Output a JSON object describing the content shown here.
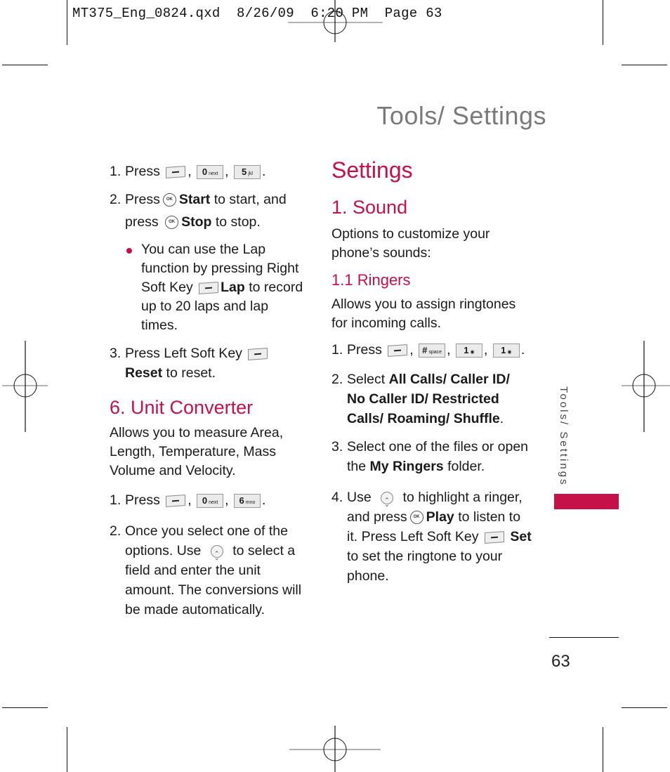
{
  "slug": {
    "filename": "MT375_Eng_0824.qxd",
    "date": "8/26/09",
    "time": "6:20 PM",
    "page_label": "Page 63"
  },
  "header": {
    "title": "Tools/ Settings"
  },
  "colors": {
    "accent": "#c5104a",
    "title_gray": "#7a7a7a",
    "text": "#1a1a1a"
  },
  "left_column": {
    "stopwatch_steps": [
      {
        "num": "1.",
        "text_before": "Press",
        "keys": [
          "left-soft-key",
          "0 next",
          "5 jkl"
        ],
        "text_after": "."
      },
      {
        "num": "2.",
        "line1_before": "Press",
        "line1_bold": "Start",
        "line1_after": "to start, and",
        "line2_before": "press",
        "line2_bold": "Stop",
        "line2_after": "to stop."
      }
    ],
    "bullet": {
      "text1": "You can use the Lap function by pressing Right Soft Key",
      "bold": "Lap",
      "text2": "to record up to 20 laps and lap times."
    },
    "step3": {
      "num": "3.",
      "before": "Press Left Soft Key",
      "bold": "Reset",
      "after": "to reset."
    },
    "unit_converter": {
      "heading": "6. Unit Converter",
      "description": "Allows you to measure Area, Length, Temperature, Mass Volume and Velocity.",
      "step1": {
        "num": "1.",
        "before": "Press",
        "keys": [
          "left-soft-key",
          "0 next",
          "6 mno"
        ],
        "after": "."
      },
      "step2": {
        "num": "2.",
        "before": "Once you select one of the options. Use",
        "after": "to select a field and enter the unit amount. The conversions will be made automatically."
      }
    }
  },
  "right_column": {
    "heading": "Settings",
    "section": "1. Sound",
    "section_desc": "Options to customize your phone’s sounds:",
    "subsection": "1.1 Ringers",
    "subsection_desc": "Allows you to assign ringtones for incoming calls.",
    "step1": {
      "num": "1.",
      "before": "Press",
      "keys": [
        "left-soft-key",
        "# space",
        "1",
        "1"
      ],
      "after": "."
    },
    "step2": {
      "num": "2.",
      "before": "Select",
      "options": "All Calls/ Caller ID/ No Caller ID/ Restricted Calls/ Roaming/ Shuffle",
      "after": "."
    },
    "step3": {
      "num": "3.",
      "before": "Select one of the files or open the",
      "bold": "My Ringers",
      "after": "folder."
    },
    "step4": {
      "num": "4.",
      "use": "Use",
      "highlight": "to highlight a ringer, and press",
      "play": "Play",
      "listen": "to listen to it. Press Left Soft Key",
      "set": "Set",
      "end": "to set the ringtone to your phone."
    }
  },
  "side_tab": {
    "label": "Tools/ Settings"
  },
  "footer": {
    "page_number": "63"
  },
  "keys": {
    "zero": {
      "num": "0",
      "sub": "next"
    },
    "five": {
      "num": "5",
      "sub": "jkl"
    },
    "six": {
      "num": "6",
      "sub": "mno"
    },
    "hash": {
      "num": "#",
      "sub": "space"
    },
    "one": {
      "num": "1",
      "sub": ""
    },
    "ok": "OK"
  }
}
